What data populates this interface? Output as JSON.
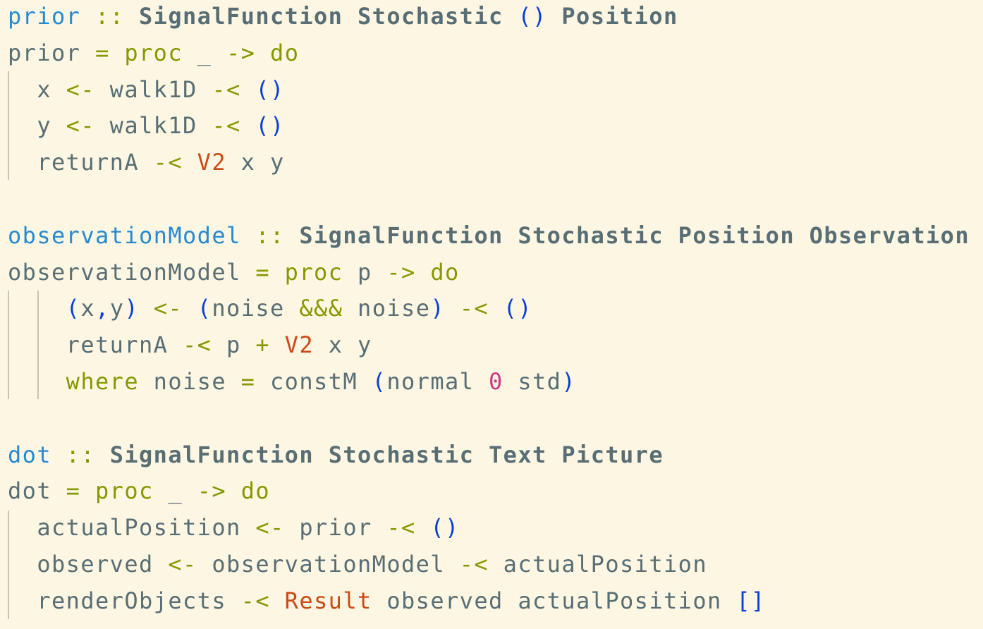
{
  "colors": {
    "background": "#fdf6e3",
    "plain": "#586e75",
    "definition": "#268bd2",
    "keyword": "#859900",
    "type": "#586e75",
    "bracket": "#0a3fd6",
    "constructor": "#cb4b16",
    "number": "#d33682",
    "indent_guide": "#c9c3b0"
  },
  "lines": [
    [
      {
        "t": "prior",
        "k": "def"
      },
      {
        "t": " ",
        "k": "plain"
      },
      {
        "t": "::",
        "k": "kw"
      },
      {
        "t": " ",
        "k": "plain"
      },
      {
        "t": "SignalFunction",
        "k": "type"
      },
      {
        "t": " ",
        "k": "plain"
      },
      {
        "t": "Stochastic",
        "k": "type"
      },
      {
        "t": " ",
        "k": "plain"
      },
      {
        "t": "()",
        "k": "bracket"
      },
      {
        "t": " ",
        "k": "plain"
      },
      {
        "t": "Position",
        "k": "type"
      }
    ],
    [
      {
        "t": "prior ",
        "k": "plain"
      },
      {
        "t": "=",
        "k": "kw"
      },
      {
        "t": " ",
        "k": "plain"
      },
      {
        "t": "proc",
        "k": "kw"
      },
      {
        "t": " _ ",
        "k": "plain"
      },
      {
        "t": "->",
        "k": "kw"
      },
      {
        "t": " ",
        "k": "plain"
      },
      {
        "t": "do",
        "k": "kw"
      }
    ],
    [
      {
        "t": "  x ",
        "k": "plain"
      },
      {
        "t": "<-",
        "k": "kw"
      },
      {
        "t": " walk1D ",
        "k": "plain"
      },
      {
        "t": "-<",
        "k": "kw"
      },
      {
        "t": " ",
        "k": "plain"
      },
      {
        "t": "()",
        "k": "bracket"
      }
    ],
    [
      {
        "t": "  y ",
        "k": "plain"
      },
      {
        "t": "<-",
        "k": "kw"
      },
      {
        "t": " walk1D ",
        "k": "plain"
      },
      {
        "t": "-<",
        "k": "kw"
      },
      {
        "t": " ",
        "k": "plain"
      },
      {
        "t": "()",
        "k": "bracket"
      }
    ],
    [
      {
        "t": "  returnA ",
        "k": "plain"
      },
      {
        "t": "-<",
        "k": "kw"
      },
      {
        "t": " ",
        "k": "plain"
      },
      {
        "t": "V2",
        "k": "ctor"
      },
      {
        "t": " x y",
        "k": "plain"
      }
    ],
    [],
    [
      {
        "t": "observationModel",
        "k": "def"
      },
      {
        "t": " ",
        "k": "plain"
      },
      {
        "t": "::",
        "k": "kw"
      },
      {
        "t": " ",
        "k": "plain"
      },
      {
        "t": "SignalFunction",
        "k": "type"
      },
      {
        "t": " ",
        "k": "plain"
      },
      {
        "t": "Stochastic",
        "k": "type"
      },
      {
        "t": " ",
        "k": "plain"
      },
      {
        "t": "Position",
        "k": "type"
      },
      {
        "t": " ",
        "k": "plain"
      },
      {
        "t": "Observation",
        "k": "type"
      }
    ],
    [
      {
        "t": "observationModel ",
        "k": "plain"
      },
      {
        "t": "=",
        "k": "kw"
      },
      {
        "t": " ",
        "k": "plain"
      },
      {
        "t": "proc",
        "k": "kw"
      },
      {
        "t": " p ",
        "k": "plain"
      },
      {
        "t": "->",
        "k": "kw"
      },
      {
        "t": " ",
        "k": "plain"
      },
      {
        "t": "do",
        "k": "kw"
      }
    ],
    [
      {
        "t": "    ",
        "k": "plain"
      },
      {
        "t": "(",
        "k": "bracket"
      },
      {
        "t": "x",
        "k": "plain"
      },
      {
        "t": ",",
        "k": "bracket"
      },
      {
        "t": "y",
        "k": "plain"
      },
      {
        "t": ")",
        "k": "bracket"
      },
      {
        "t": " ",
        "k": "plain"
      },
      {
        "t": "<-",
        "k": "kw"
      },
      {
        "t": " ",
        "k": "plain"
      },
      {
        "t": "(",
        "k": "bracket"
      },
      {
        "t": "noise ",
        "k": "plain"
      },
      {
        "t": "&&&",
        "k": "kw"
      },
      {
        "t": " noise",
        "k": "plain"
      },
      {
        "t": ")",
        "k": "bracket"
      },
      {
        "t": " ",
        "k": "plain"
      },
      {
        "t": "-<",
        "k": "kw"
      },
      {
        "t": " ",
        "k": "plain"
      },
      {
        "t": "()",
        "k": "bracket"
      }
    ],
    [
      {
        "t": "    returnA ",
        "k": "plain"
      },
      {
        "t": "-<",
        "k": "kw"
      },
      {
        "t": " p ",
        "k": "plain"
      },
      {
        "t": "+",
        "k": "kw"
      },
      {
        "t": " ",
        "k": "plain"
      },
      {
        "t": "V2",
        "k": "ctor"
      },
      {
        "t": " x y",
        "k": "plain"
      }
    ],
    [
      {
        "t": "    ",
        "k": "plain"
      },
      {
        "t": "where",
        "k": "kw"
      },
      {
        "t": " noise ",
        "k": "plain"
      },
      {
        "t": "=",
        "k": "kw"
      },
      {
        "t": " constM ",
        "k": "plain"
      },
      {
        "t": "(",
        "k": "bracket"
      },
      {
        "t": "normal ",
        "k": "plain"
      },
      {
        "t": "0",
        "k": "num"
      },
      {
        "t": " std",
        "k": "plain"
      },
      {
        "t": ")",
        "k": "bracket"
      }
    ],
    [],
    [
      {
        "t": "dot",
        "k": "def"
      },
      {
        "t": " ",
        "k": "plain"
      },
      {
        "t": "::",
        "k": "kw"
      },
      {
        "t": " ",
        "k": "plain"
      },
      {
        "t": "SignalFunction",
        "k": "type"
      },
      {
        "t": " ",
        "k": "plain"
      },
      {
        "t": "Stochastic",
        "k": "type"
      },
      {
        "t": " ",
        "k": "plain"
      },
      {
        "t": "Text",
        "k": "type"
      },
      {
        "t": " ",
        "k": "plain"
      },
      {
        "t": "Picture",
        "k": "type"
      }
    ],
    [
      {
        "t": "dot ",
        "k": "plain"
      },
      {
        "t": "=",
        "k": "kw"
      },
      {
        "t": " ",
        "k": "plain"
      },
      {
        "t": "proc",
        "k": "kw"
      },
      {
        "t": " _ ",
        "k": "plain"
      },
      {
        "t": "->",
        "k": "kw"
      },
      {
        "t": " ",
        "k": "plain"
      },
      {
        "t": "do",
        "k": "kw"
      }
    ],
    [
      {
        "t": "  actualPosition ",
        "k": "plain"
      },
      {
        "t": "<-",
        "k": "kw"
      },
      {
        "t": " prior ",
        "k": "plain"
      },
      {
        "t": "-<",
        "k": "kw"
      },
      {
        "t": " ",
        "k": "plain"
      },
      {
        "t": "()",
        "k": "bracket"
      }
    ],
    [
      {
        "t": "  observed ",
        "k": "plain"
      },
      {
        "t": "<-",
        "k": "kw"
      },
      {
        "t": " observationModel ",
        "k": "plain"
      },
      {
        "t": "-<",
        "k": "kw"
      },
      {
        "t": " actualPosition",
        "k": "plain"
      }
    ],
    [
      {
        "t": "  renderObjects ",
        "k": "plain"
      },
      {
        "t": "-<",
        "k": "kw"
      },
      {
        "t": " ",
        "k": "plain"
      },
      {
        "t": "Result",
        "k": "ctor"
      },
      {
        "t": " observed actualPosition ",
        "k": "plain"
      },
      {
        "t": "[]",
        "k": "bracket"
      }
    ]
  ]
}
